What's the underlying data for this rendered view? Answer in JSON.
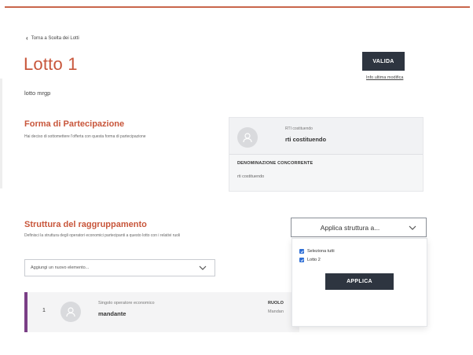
{
  "breadcrumb": {
    "back_label": "Torna a Scelta dei Lotti"
  },
  "header": {
    "title": "Lotto 1",
    "valida_label": "VALIDA",
    "info_link": "Info ultima modifica",
    "subtitle": "lotto mrgp"
  },
  "forma": {
    "title": "Forma di Partecipazione",
    "description": "Hai deciso di sottomettere l'offerta con questa forma di partecipazione",
    "card": {
      "small": "RTI costituendo",
      "strong": "rti costituendo",
      "denominazione_label": "DENOMINAZIONE CONCORRENTE",
      "denominazione_value": "rti costituendo"
    }
  },
  "struttura": {
    "title": "Struttura del raggruppamento",
    "description": "Definisci la struttura degli operatori economici partecipanti a questo lotto con i relativi ruoli",
    "apply_select_label": "Applica struttura a...",
    "add_placeholder": "Aggiungi un nuovo elemento...",
    "dropdown": {
      "options": [
        {
          "label": "Seleziona tutti",
          "checked": true
        },
        {
          "label": "Lotto 2",
          "checked": true
        }
      ],
      "applica_label": "APPLICA"
    },
    "row": {
      "number": "1",
      "small": "Singolo operatore economico",
      "strong": "mandante",
      "ruolo_label": "RUOLO",
      "ruolo_value": "Mandan"
    }
  },
  "colors": {
    "accent": "#c8563b",
    "dark_button": "#2e3540",
    "row_marker": "#7a3f86",
    "checkbox": "#2f6fd6"
  },
  "icons": [
    "chevron-left-icon",
    "user-avatar-icon",
    "chevron-down-icon",
    "checkbox-checked-icon"
  ]
}
